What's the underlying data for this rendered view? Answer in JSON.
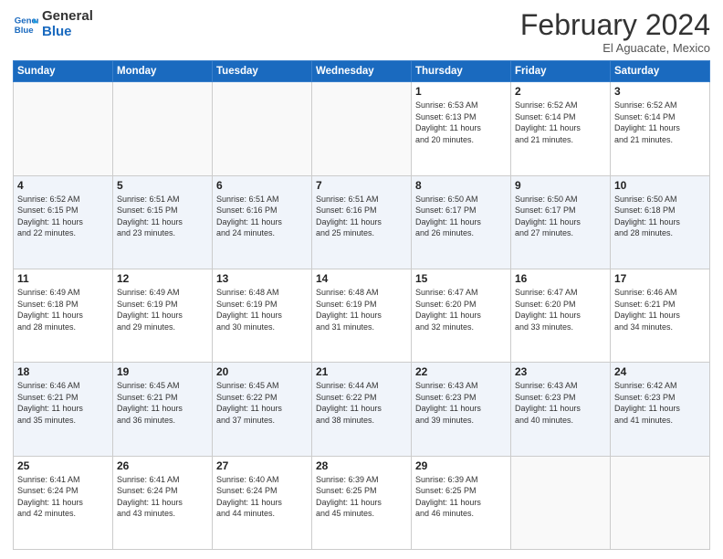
{
  "logo": {
    "line1": "General",
    "line2": "Blue"
  },
  "header": {
    "month": "February 2024",
    "location": "El Aguacate, Mexico"
  },
  "weekdays": [
    "Sunday",
    "Monday",
    "Tuesday",
    "Wednesday",
    "Thursday",
    "Friday",
    "Saturday"
  ],
  "rows": [
    [
      {
        "day": "",
        "info": ""
      },
      {
        "day": "",
        "info": ""
      },
      {
        "day": "",
        "info": ""
      },
      {
        "day": "",
        "info": ""
      },
      {
        "day": "1",
        "info": "Sunrise: 6:53 AM\nSunset: 6:13 PM\nDaylight: 11 hours\nand 20 minutes."
      },
      {
        "day": "2",
        "info": "Sunrise: 6:52 AM\nSunset: 6:14 PM\nDaylight: 11 hours\nand 21 minutes."
      },
      {
        "day": "3",
        "info": "Sunrise: 6:52 AM\nSunset: 6:14 PM\nDaylight: 11 hours\nand 21 minutes."
      }
    ],
    [
      {
        "day": "4",
        "info": "Sunrise: 6:52 AM\nSunset: 6:15 PM\nDaylight: 11 hours\nand 22 minutes."
      },
      {
        "day": "5",
        "info": "Sunrise: 6:51 AM\nSunset: 6:15 PM\nDaylight: 11 hours\nand 23 minutes."
      },
      {
        "day": "6",
        "info": "Sunrise: 6:51 AM\nSunset: 6:16 PM\nDaylight: 11 hours\nand 24 minutes."
      },
      {
        "day": "7",
        "info": "Sunrise: 6:51 AM\nSunset: 6:16 PM\nDaylight: 11 hours\nand 25 minutes."
      },
      {
        "day": "8",
        "info": "Sunrise: 6:50 AM\nSunset: 6:17 PM\nDaylight: 11 hours\nand 26 minutes."
      },
      {
        "day": "9",
        "info": "Sunrise: 6:50 AM\nSunset: 6:17 PM\nDaylight: 11 hours\nand 27 minutes."
      },
      {
        "day": "10",
        "info": "Sunrise: 6:50 AM\nSunset: 6:18 PM\nDaylight: 11 hours\nand 28 minutes."
      }
    ],
    [
      {
        "day": "11",
        "info": "Sunrise: 6:49 AM\nSunset: 6:18 PM\nDaylight: 11 hours\nand 28 minutes."
      },
      {
        "day": "12",
        "info": "Sunrise: 6:49 AM\nSunset: 6:19 PM\nDaylight: 11 hours\nand 29 minutes."
      },
      {
        "day": "13",
        "info": "Sunrise: 6:48 AM\nSunset: 6:19 PM\nDaylight: 11 hours\nand 30 minutes."
      },
      {
        "day": "14",
        "info": "Sunrise: 6:48 AM\nSunset: 6:19 PM\nDaylight: 11 hours\nand 31 minutes."
      },
      {
        "day": "15",
        "info": "Sunrise: 6:47 AM\nSunset: 6:20 PM\nDaylight: 11 hours\nand 32 minutes."
      },
      {
        "day": "16",
        "info": "Sunrise: 6:47 AM\nSunset: 6:20 PM\nDaylight: 11 hours\nand 33 minutes."
      },
      {
        "day": "17",
        "info": "Sunrise: 6:46 AM\nSunset: 6:21 PM\nDaylight: 11 hours\nand 34 minutes."
      }
    ],
    [
      {
        "day": "18",
        "info": "Sunrise: 6:46 AM\nSunset: 6:21 PM\nDaylight: 11 hours\nand 35 minutes."
      },
      {
        "day": "19",
        "info": "Sunrise: 6:45 AM\nSunset: 6:21 PM\nDaylight: 11 hours\nand 36 minutes."
      },
      {
        "day": "20",
        "info": "Sunrise: 6:45 AM\nSunset: 6:22 PM\nDaylight: 11 hours\nand 37 minutes."
      },
      {
        "day": "21",
        "info": "Sunrise: 6:44 AM\nSunset: 6:22 PM\nDaylight: 11 hours\nand 38 minutes."
      },
      {
        "day": "22",
        "info": "Sunrise: 6:43 AM\nSunset: 6:23 PM\nDaylight: 11 hours\nand 39 minutes."
      },
      {
        "day": "23",
        "info": "Sunrise: 6:43 AM\nSunset: 6:23 PM\nDaylight: 11 hours\nand 40 minutes."
      },
      {
        "day": "24",
        "info": "Sunrise: 6:42 AM\nSunset: 6:23 PM\nDaylight: 11 hours\nand 41 minutes."
      }
    ],
    [
      {
        "day": "25",
        "info": "Sunrise: 6:41 AM\nSunset: 6:24 PM\nDaylight: 11 hours\nand 42 minutes."
      },
      {
        "day": "26",
        "info": "Sunrise: 6:41 AM\nSunset: 6:24 PM\nDaylight: 11 hours\nand 43 minutes."
      },
      {
        "day": "27",
        "info": "Sunrise: 6:40 AM\nSunset: 6:24 PM\nDaylight: 11 hours\nand 44 minutes."
      },
      {
        "day": "28",
        "info": "Sunrise: 6:39 AM\nSunset: 6:25 PM\nDaylight: 11 hours\nand 45 minutes."
      },
      {
        "day": "29",
        "info": "Sunrise: 6:39 AM\nSunset: 6:25 PM\nDaylight: 11 hours\nand 46 minutes."
      },
      {
        "day": "",
        "info": ""
      },
      {
        "day": "",
        "info": ""
      }
    ]
  ]
}
